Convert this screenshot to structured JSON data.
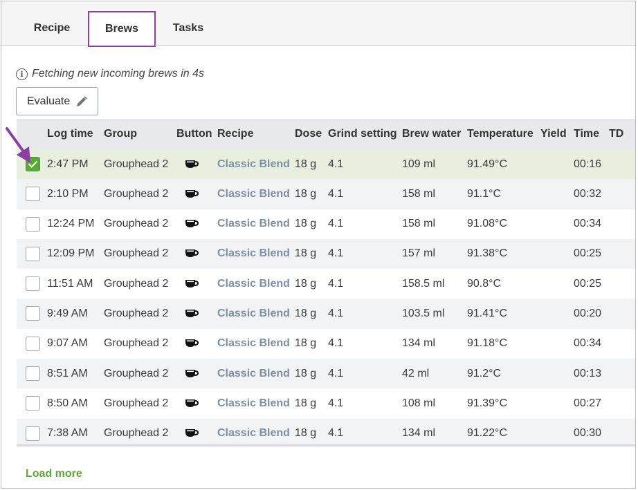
{
  "tabs": [
    {
      "label": "Recipe"
    },
    {
      "label": "Brews"
    },
    {
      "label": "Tasks"
    }
  ],
  "info_text": "Fetching new incoming brews in 4s",
  "evaluate_label": "Evaluate",
  "columns": [
    "Log time",
    "Group",
    "Button",
    "Recipe",
    "Dose",
    "Grind setting",
    "Brew water",
    "Temperature",
    "Yield",
    "Time",
    "TD"
  ],
  "rows": [
    {
      "time": "2:47 PM",
      "group": "Grouphead 2",
      "recipe": "Classic Blend",
      "dose": "18 g",
      "grind": "4.1",
      "water": "109 ml",
      "temp": "91.49°C",
      "yield": "",
      "dur": "00:16",
      "checked": true
    },
    {
      "time": "2:10 PM",
      "group": "Grouphead 2",
      "recipe": "Classic Blend",
      "dose": "18 g",
      "grind": "4.1",
      "water": "158 ml",
      "temp": "91.1°C",
      "yield": "",
      "dur": "00:32",
      "checked": false
    },
    {
      "time": "12:24 PM",
      "group": "Grouphead 2",
      "recipe": "Classic Blend",
      "dose": "18 g",
      "grind": "4.1",
      "water": "158 ml",
      "temp": "91.08°C",
      "yield": "",
      "dur": "00:34",
      "checked": false
    },
    {
      "time": "12:09 PM",
      "group": "Grouphead 2",
      "recipe": "Classic Blend",
      "dose": "18 g",
      "grind": "4.1",
      "water": "157 ml",
      "temp": "91.38°C",
      "yield": "",
      "dur": "00:25",
      "checked": false
    },
    {
      "time": "11:51 AM",
      "group": "Grouphead 2",
      "recipe": "Classic Blend",
      "dose": "18 g",
      "grind": "4.1",
      "water": "158.5 ml",
      "temp": "90.8°C",
      "yield": "",
      "dur": "00:25",
      "checked": false
    },
    {
      "time": "9:49 AM",
      "group": "Grouphead 2",
      "recipe": "Classic Blend",
      "dose": "18 g",
      "grind": "4.1",
      "water": "103.5 ml",
      "temp": "91.41°C",
      "yield": "",
      "dur": "00:20",
      "checked": false
    },
    {
      "time": "9:07 AM",
      "group": "Grouphead 2",
      "recipe": "Classic Blend",
      "dose": "18 g",
      "grind": "4.1",
      "water": "134 ml",
      "temp": "91.18°C",
      "yield": "",
      "dur": "00:34",
      "checked": false
    },
    {
      "time": "8:51 AM",
      "group": "Grouphead 2",
      "recipe": "Classic Blend",
      "dose": "18 g",
      "grind": "4.1",
      "water": "42 ml",
      "temp": "91.2°C",
      "yield": "",
      "dur": "00:13",
      "checked": false
    },
    {
      "time": "8:50 AM",
      "group": "Grouphead 2",
      "recipe": "Classic Blend",
      "dose": "18 g",
      "grind": "4.1",
      "water": "108 ml",
      "temp": "91.39°C",
      "yield": "",
      "dur": "00:27",
      "checked": false
    },
    {
      "time": "7:38 AM",
      "group": "Grouphead 2",
      "recipe": "Classic Blend",
      "dose": "18 g",
      "grind": "4.1",
      "water": "134 ml",
      "temp": "91.22°C",
      "yield": "",
      "dur": "00:30",
      "checked": false
    }
  ],
  "button_icon": "espresso-cup-icon",
  "load_more_label": "Load more",
  "colors": {
    "accent_purple": "#8d3fa0",
    "check_green": "#5aaa3a",
    "link_green": "#5fa63c",
    "recipe_link": "#7f8fa0"
  }
}
